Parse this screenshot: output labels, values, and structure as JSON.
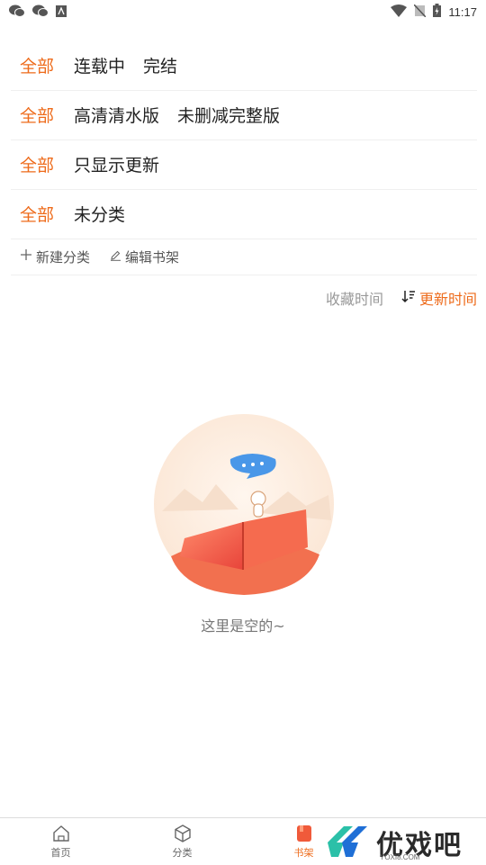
{
  "status_bar": {
    "time": "11:17",
    "left_icons": [
      "wechat-icon",
      "wechat-icon",
      "app-icon"
    ],
    "right_icons": [
      "wifi-icon",
      "no-sim-icon",
      "battery-charging-icon"
    ]
  },
  "filters": [
    {
      "all_label": "全部",
      "options": [
        "连载中",
        "完结"
      ]
    },
    {
      "all_label": "全部",
      "options": [
        "高清清水版",
        "未删减完整版"
      ]
    },
    {
      "all_label": "全部",
      "options": [
        "只显示更新"
      ]
    },
    {
      "all_label": "全部",
      "options": [
        "未分类"
      ]
    }
  ],
  "actions": {
    "new_category": "新建分类",
    "edit_shelf": "编辑书架"
  },
  "sort": {
    "by_favorite": "收藏时间",
    "by_update": "更新时间",
    "active": "by_update"
  },
  "empty_state": {
    "message": "这里是空的~"
  },
  "tabbar": {
    "items": [
      {
        "label": "首页",
        "icon": "home-icon"
      },
      {
        "label": "分类",
        "icon": "cube-icon"
      },
      {
        "label": "书架",
        "icon": "bookshelf-icon"
      },
      {
        "label": "",
        "icon": ""
      }
    ],
    "active_index": 2
  },
  "watermark": {
    "text": "优戏吧",
    "sub": "YOXI8.COM"
  },
  "colors": {
    "accent": "#ee6b1b",
    "divider": "#efefef"
  }
}
